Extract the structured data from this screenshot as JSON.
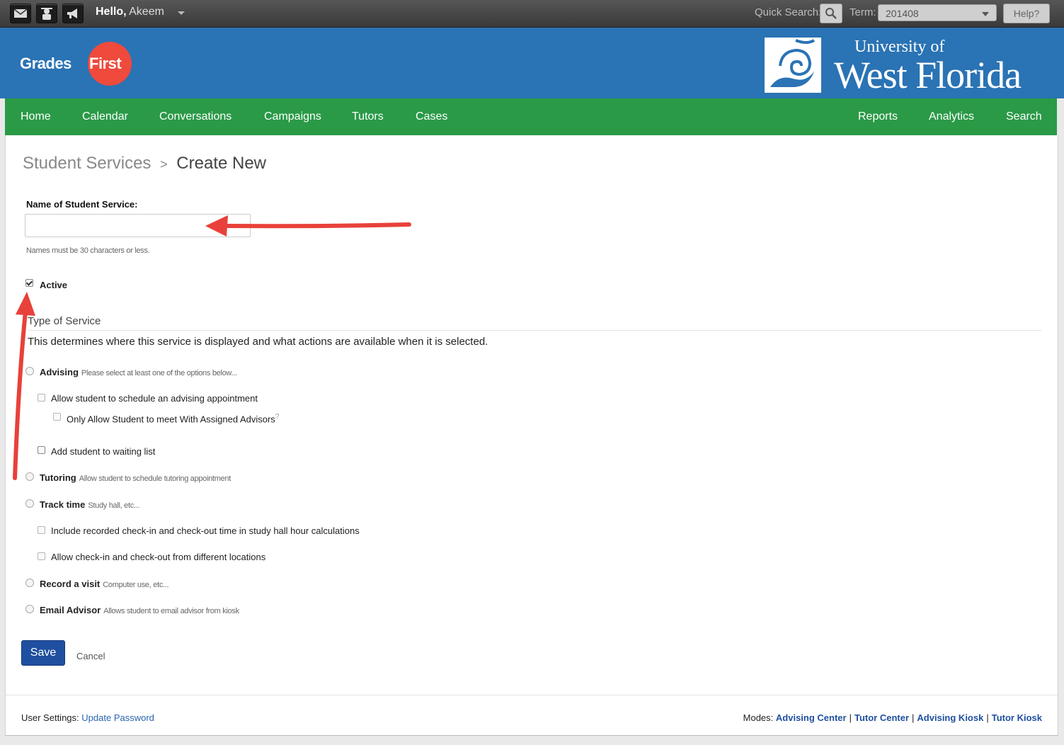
{
  "topbar": {
    "hello": "Hello,",
    "user": "Akeem",
    "quick_search_label": "Quick Search:",
    "term_label": "Term:",
    "term_value": "201408",
    "help_label": "Help?"
  },
  "header": {
    "logo_grades": "Grades",
    "logo_first": "First",
    "university_line1": "University of",
    "university_line2": "West Florida"
  },
  "nav": {
    "left": [
      "Home",
      "Calendar",
      "Conversations",
      "Campaigns",
      "Tutors",
      "Cases"
    ],
    "right": [
      "Reports",
      "Analytics",
      "Search"
    ]
  },
  "breadcrumb": {
    "parent": "Student Services",
    "separator": ">",
    "current": "Create New"
  },
  "form": {
    "name_label": "Name of Student Service:",
    "name_value": "",
    "name_hint": "Names must be 30 characters or less.",
    "active_label": "Active",
    "active_checked": true,
    "section_title": "Type of Service",
    "section_desc": "This determines where this service is displayed and what actions are available when it is selected.",
    "advising": {
      "label": "Advising",
      "desc": "Please select at least one of the options below...",
      "opt_schedule": "Allow student to schedule an advising appointment",
      "opt_assigned": "Only Allow Student to meet With Assigned Advisors",
      "opt_assigned_help": "?",
      "opt_waitlist": "Add student to waiting list"
    },
    "tutoring": {
      "label": "Tutoring",
      "desc": "Allow student to schedule tutoring appointment"
    },
    "track_time": {
      "label": "Track time",
      "desc": "Study hall, etc...",
      "opt_include": "Include recorded check-in and check-out time in study hall hour calculations",
      "opt_locations": "Allow check-in and check-out from different locations"
    },
    "record_visit": {
      "label": "Record a visit",
      "desc": "Computer use, etc..."
    },
    "email_advisor": {
      "label": "Email Advisor",
      "desc": "Allows student to email advisor from kiosk"
    },
    "save_label": "Save",
    "cancel_label": "Cancel"
  },
  "footer": {
    "settings_label": "User Settings:",
    "update_password": "Update Password",
    "modes_label": "Modes:",
    "modes": [
      "Advising Center",
      "Tutor Center",
      "Advising Kiosk",
      "Tutor Kiosk"
    ],
    "separator": "|"
  },
  "colors": {
    "header_blue": "#2a73b4",
    "nav_green": "#2a9a47",
    "annotation_red": "#e8413a",
    "save_blue": "#1f4fa0"
  }
}
